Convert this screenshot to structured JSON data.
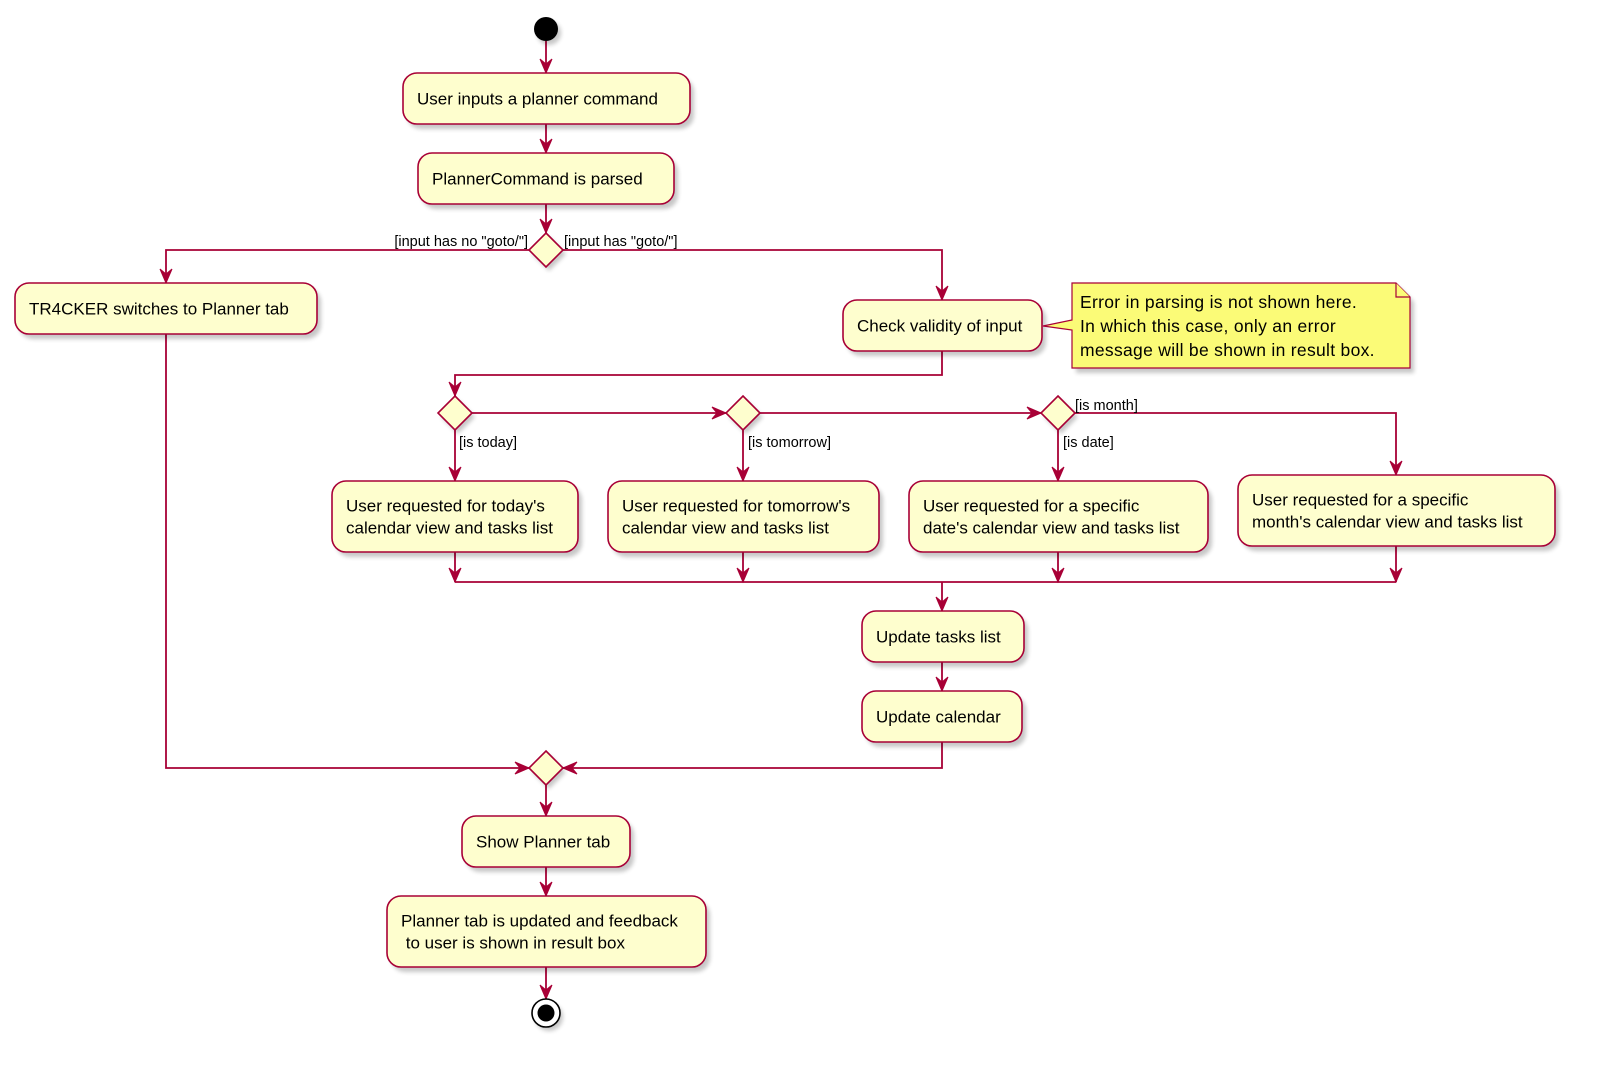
{
  "diagram": {
    "type": "activity",
    "colors": {
      "activity_fill": "#FEFECE",
      "border": "#A80036",
      "note_fill": "#FBFB77",
      "start_node": "#000000"
    },
    "nodes": {
      "start": {
        "kind": "start"
      },
      "user_inputs": {
        "kind": "action",
        "lines": [
          "User inputs a planner command"
        ]
      },
      "parsed": {
        "kind": "action",
        "lines": [
          "PlannerCommand is parsed"
        ]
      },
      "decision_goto": {
        "kind": "decision"
      },
      "switch_tab": {
        "kind": "action",
        "lines": [
          "TR4CKER switches to Planner tab"
        ]
      },
      "check_validity": {
        "kind": "action",
        "lines": [
          "Check validity of input"
        ]
      },
      "note": {
        "kind": "note",
        "lines": [
          "Error in parsing is not shown here.",
          "In which this case, only an error",
          "message will be shown in result box."
        ]
      },
      "decision_today": {
        "kind": "decision"
      },
      "decision_tomorrow": {
        "kind": "decision"
      },
      "decision_date": {
        "kind": "decision"
      },
      "today": {
        "kind": "action",
        "lines": [
          "User requested for today's",
          "calendar view and tasks list"
        ]
      },
      "tomorrow": {
        "kind": "action",
        "lines": [
          "User requested for tomorrow's",
          "calendar view and tasks list"
        ]
      },
      "date": {
        "kind": "action",
        "lines": [
          "User requested for a specific",
          "date's calendar view and tasks list"
        ]
      },
      "month": {
        "kind": "action",
        "lines": [
          "User requested for a specific",
          "month's calendar view and tasks list"
        ]
      },
      "update_tasks": {
        "kind": "action",
        "lines": [
          "Update tasks list"
        ]
      },
      "update_calendar": {
        "kind": "action",
        "lines": [
          "Update calendar"
        ]
      },
      "merge": {
        "kind": "merge"
      },
      "show_tab": {
        "kind": "action",
        "lines": [
          "Show Planner tab"
        ]
      },
      "updated_feedback": {
        "kind": "action",
        "lines": [
          "Planner tab is updated and feedback",
          " to user is shown in result box"
        ]
      },
      "end": {
        "kind": "end"
      }
    },
    "guards": {
      "no_goto": "[input has no \"goto/\"]",
      "has_goto": "[input has \"goto/\"]",
      "is_today": "[is today]",
      "is_tomorrow": "[is tomorrow]",
      "is_date": "[is date]",
      "is_month": "[is month]"
    },
    "edges": [
      [
        "start",
        "user_inputs"
      ],
      [
        "user_inputs",
        "parsed"
      ],
      [
        "parsed",
        "decision_goto"
      ],
      [
        "decision_goto",
        "switch_tab",
        "no_goto"
      ],
      [
        "decision_goto",
        "check_validity",
        "has_goto"
      ],
      [
        "check_validity",
        "decision_today"
      ],
      [
        "decision_today",
        "today",
        "is_today"
      ],
      [
        "decision_today",
        "decision_tomorrow"
      ],
      [
        "decision_tomorrow",
        "tomorrow",
        "is_tomorrow"
      ],
      [
        "decision_tomorrow",
        "decision_date"
      ],
      [
        "decision_date",
        "date",
        "is_date"
      ],
      [
        "decision_date",
        "month",
        "is_month"
      ],
      [
        "today",
        "update_tasks"
      ],
      [
        "tomorrow",
        "update_tasks"
      ],
      [
        "date",
        "update_tasks"
      ],
      [
        "month",
        "update_tasks"
      ],
      [
        "update_tasks",
        "update_calendar"
      ],
      [
        "update_calendar",
        "merge"
      ],
      [
        "switch_tab",
        "merge"
      ],
      [
        "merge",
        "show_tab"
      ],
      [
        "show_tab",
        "updated_feedback"
      ],
      [
        "updated_feedback",
        "end"
      ]
    ]
  }
}
